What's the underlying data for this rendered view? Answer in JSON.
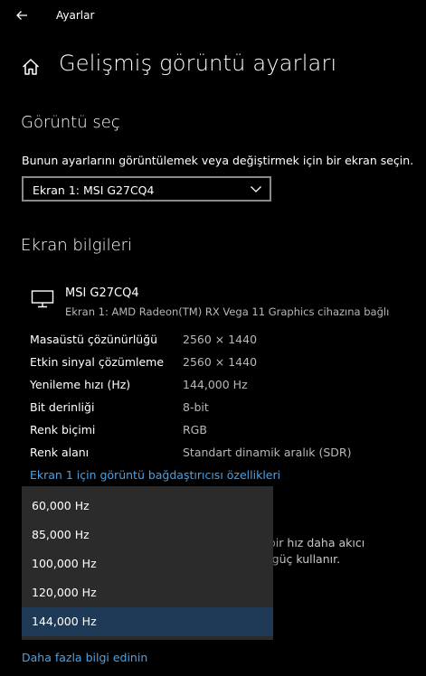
{
  "titlebar": {
    "title": "Ayarlar",
    "back_icon": "arrow-left-icon"
  },
  "header": {
    "title": "Gelişmiş görüntü ayarları",
    "home_icon": "home-icon"
  },
  "display_select": {
    "heading": "Görüntü seç",
    "description": "Bunun ayarlarını görüntülemek veya değiştirmek için bir ekran seçin.",
    "selected": "Ekran 1: MSI G27CQ4"
  },
  "display_info": {
    "heading": "Ekran bilgileri",
    "monitor_name": "MSI G27CQ4",
    "monitor_sub": "Ekran 1: AMD Radeon(TM) RX Vega 11 Graphics cihazına bağlı",
    "rows": [
      {
        "label": "Masaüstü çözünürlüğü",
        "value": "2560 × 1440"
      },
      {
        "label": "Etkin sinyal çözümleme",
        "value": "2560 × 1440"
      },
      {
        "label": "Yenileme hızı (Hz)",
        "value": "144,000 Hz"
      },
      {
        "label": "Bit derinliği",
        "value": "8-bit"
      },
      {
        "label": "Renk biçimi",
        "value": "RGB"
      },
      {
        "label": "Renk alanı",
        "value": "Standart dinamik aralık (SDR)"
      }
    ],
    "adapter_link": "Ekran 1 için görüntü bağdaştırıcısı özellikleri"
  },
  "refresh_dropdown": {
    "options": [
      "60,000 Hz",
      "85,000 Hz",
      "100,000 Hz",
      "120,000 Hz",
      "144,000 Hz"
    ],
    "selected_index": 4
  },
  "behind_text": {
    "line1": "t bir hız daha akıcı",
    "line2": "a güç kullanır."
  },
  "more_info_link": "Daha fazla bilgi edinin",
  "colors": {
    "background": "#000000",
    "link": "#4aa3ea",
    "dropdown_bg": "#2b2b2b",
    "selected_bg": "#1f3a56"
  }
}
